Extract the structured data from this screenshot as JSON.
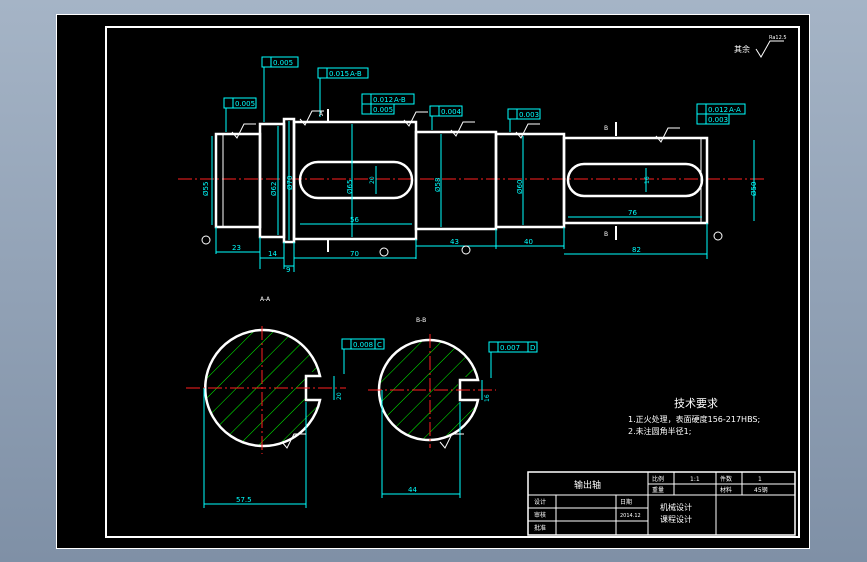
{
  "colors": {
    "line": "#ffffff",
    "dimension": "#00ffff",
    "hatch": "#00ff00",
    "center": "#ff2020",
    "background": "#000000"
  },
  "roughness": {
    "remaining": "其余",
    "remaining_value": "Ra12.5",
    "surface_mark": "Ra0.8"
  },
  "tolerances": [
    {
      "value": "0.005",
      "datum": ""
    },
    {
      "value": "0.015",
      "datum": "A-B"
    },
    {
      "value": "0.005",
      "datum": ""
    },
    {
      "value": "0.012",
      "datum": "A-B"
    },
    {
      "value": "0.005",
      "datum": ""
    },
    {
      "value": "0.004",
      "datum": ""
    },
    {
      "value": "0.003",
      "datum": ""
    },
    {
      "value": "0.012",
      "datum": "A-A"
    },
    {
      "value": "0.003",
      "datum": ""
    }
  ],
  "diameters": [
    "Ø55",
    "Ø62",
    "Ø70",
    "Ø65",
    "Ø58",
    "Ø60",
    "Ø50"
  ],
  "lengths": {
    "d23": "23",
    "d14": "14",
    "d9": "9",
    "d56": "56",
    "d70": "70",
    "d43": "43",
    "d40": "40",
    "d76": "76",
    "d82": "82"
  },
  "keyway": {
    "w20": "20",
    "w16": "16"
  },
  "section_labels": {
    "a": "A",
    "b": "B",
    "aa": "A-A",
    "bb": "B-B"
  },
  "sections": {
    "aa_tol": "0.008",
    "aa_datum": "C",
    "aa_depth": "20",
    "aa_dim": "57.5",
    "bb_tol": "0.007",
    "bb_datum": "D",
    "bb_depth": "16",
    "bb_dim": "44"
  },
  "tech": {
    "title": "技术要求",
    "line1": "1.正火处理，表面硬度156-217HBS;",
    "line2": "2.未注圆角半径1;"
  },
  "title_block": {
    "part_name": "输出轴",
    "scale_label": "比例",
    "scale_value": "1:1",
    "weight_label": "重量",
    "weight_value": "",
    "material_label": "材料",
    "material_value": "45钢",
    "count_label": "件数",
    "count_value": "1",
    "designer_label": "设计",
    "checker_label": "审核",
    "approver_label": "批准",
    "date_label": "日期",
    "date_value": "2014.12",
    "course_line1": "机械设计",
    "course_line2": "课程设计"
  }
}
